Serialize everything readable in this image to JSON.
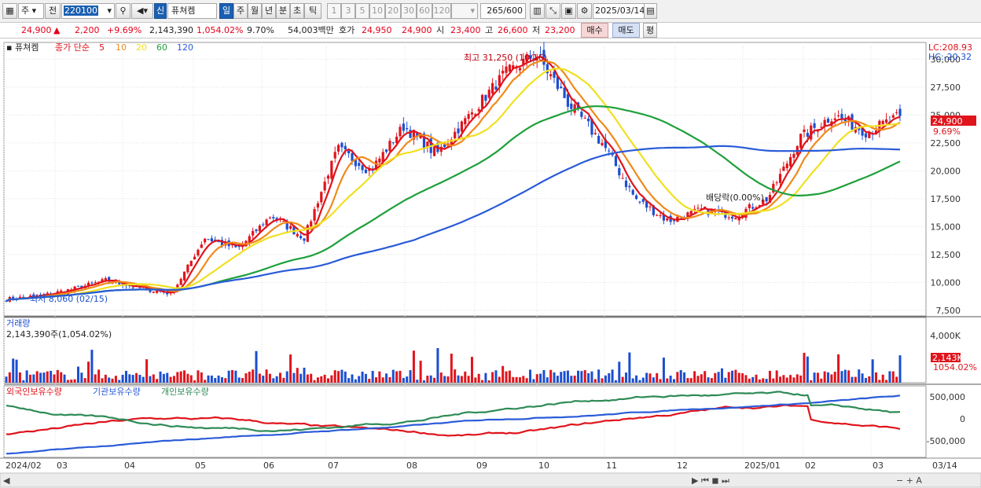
{
  "toolbar": {
    "period_btn": "주",
    "adj_btn": "전",
    "code": "220100",
    "name_tag": "신",
    "stock_name": "퓨쳐켐",
    "periods": [
      "일",
      "주",
      "월",
      "년",
      "분",
      "초",
      "틱"
    ],
    "intervals": [
      "1",
      "3",
      "5",
      "10",
      "20",
      "30",
      "60",
      "120"
    ],
    "count": "265",
    "count_total": "/600",
    "date": "2025/03/14"
  },
  "quote": {
    "price": "24,900",
    "arrow": "▲",
    "change": "2,200",
    "rate": "+9.69%",
    "volume": "2,143,390",
    "volume_rate": "1,054.02%",
    "turnover": "9.70%",
    "amount": "54,003백만",
    "ask_label": "호가",
    "ask1": "24,950",
    "ask2": "24,900",
    "open_label": "시",
    "open": "23,400",
    "high_label": "고",
    "high": "26,600",
    "low_label": "저",
    "low": "23,200",
    "buy": "매수",
    "sell": "매도",
    "avg": "평"
  },
  "price_panel": {
    "name": "퓨쳐켐",
    "legend_prefix": "종가 단순",
    "ma": [
      {
        "label": "5",
        "color": "#e0141c"
      },
      {
        "label": "10",
        "color": "#f08a1a"
      },
      {
        "label": "20",
        "color": "#f0e020"
      },
      {
        "label": "60",
        "color": "#1ea03a"
      },
      {
        "label": "120",
        "color": "#2a5bd8"
      }
    ],
    "lc": "LC:208.93",
    "hc": "HC:-20.32",
    "y_ticks": [
      "30,000",
      "27,500",
      "25,000",
      "22,500",
      "20,000",
      "17,500",
      "15,000",
      "12,500",
      "10,000",
      "7,500"
    ],
    "high_note": "최고 31,250 (10/16)",
    "low_note": "최저 8,060 (02/15)",
    "dividend_note": "배당락(0.00%)",
    "last_price_tag": "24,900",
    "last_rate_tag": "9.69%"
  },
  "volume_panel": {
    "title": "거래량",
    "value": "2,143,390주(1,054.02%)",
    "tick": "4,000K",
    "tag1": "2,143K",
    "tag2": "1054.02%"
  },
  "holders_panel": {
    "title1": "외국인보유수량",
    "title2": "기관보유수량",
    "title3": "개인보유수량",
    "ticks": [
      "500,000",
      "0",
      "-500,000"
    ],
    "colors": {
      "foreign": "#e0141c",
      "inst": "#2a5bd8",
      "indiv": "#2e8b57"
    }
  },
  "x_axis": [
    "2024/02",
    "03",
    "04",
    "05",
    "06",
    "07",
    "08",
    "09",
    "10",
    "11",
    "12",
    "2025/01",
    "02",
    "03"
  ],
  "x_axis_end": "03/14",
  "colors": {
    "up": "#e0141c",
    "down": "#1b4fd0"
  },
  "chart_data": {
    "type": "candlestick",
    "x_range": [
      "2024/02",
      "2025/03/14"
    ],
    "ylim": [
      7000,
      31500
    ],
    "approx_close_path": [
      8500,
      8800,
      9400,
      10200,
      9500,
      9000,
      14000,
      13000,
      16000,
      14000,
      22000,
      20000,
      24000,
      21500,
      25000,
      28500,
      30500,
      26000,
      22500,
      17500,
      15500,
      16500,
      16000,
      17500,
      23000,
      25000,
      23500,
      24900
    ],
    "max_high": 31250,
    "min_low": 8060,
    "last_close": 24900
  }
}
